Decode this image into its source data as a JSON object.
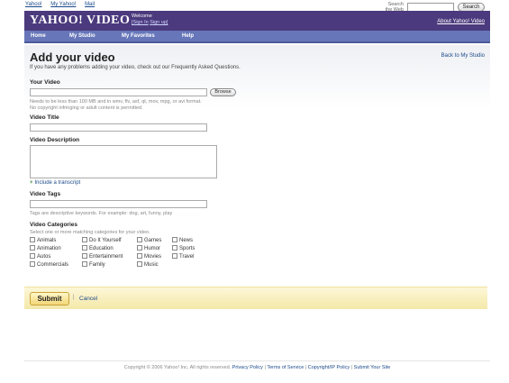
{
  "topnav": {
    "yahoo": "Yahoo!",
    "my_yahoo": "My Yahoo!",
    "mail": "Mail"
  },
  "search": {
    "label_line1": "Search",
    "label_line2": "the Web",
    "button": "Search"
  },
  "header": {
    "logo": "YAHOO! VIDEO",
    "welcome": "Welcome",
    "signin": "[Sign In",
    "signup": "Sign up]",
    "about": "About Yahoo! Video"
  },
  "menu": [
    "Home",
    "My Studio",
    "My Favorites",
    "Help"
  ],
  "page": {
    "title": "Add your video",
    "subtitle": "If you have any problems adding your video, check out our Frequently Asked Questions.",
    "back": "Back to My Studio"
  },
  "form": {
    "video": {
      "label": "Your Video",
      "browse": "Browse",
      "hint1": "Needs to be less than 100 MB and in wmv, flv, asf, qt, mov, mpg, or avi format.",
      "hint2": "No copyright infringing or adult content is permitted."
    },
    "title": {
      "label": "Video Title"
    },
    "description": {
      "label": "Video Description",
      "transcript": "Include a transcript"
    },
    "tags": {
      "label": "Video Tags",
      "hint": "Tags are descriptive keywords. For example: dog, art, funny, play"
    },
    "categories": {
      "label": "Video Categories",
      "hint": "Select one or more matching categories for your video.",
      "items": [
        [
          "Animals",
          "Animation",
          "Autos",
          "Commercials"
        ],
        [
          "Do It Yourself",
          "Education",
          "Entertainment",
          "Family"
        ],
        [
          "Games",
          "Humor",
          "Movies",
          "Music"
        ],
        [
          "News",
          "Sports",
          "Travel"
        ]
      ]
    }
  },
  "actions": {
    "submit": "Submit",
    "separator": "|",
    "cancel": "Cancel"
  },
  "footer": {
    "copyright": "Copyright © 2006 Yahoo! Inc. All rights reserved.",
    "privacy": "Privacy Policy",
    "terms": "Terms of Service",
    "copyright_ip": "Copyright/IP Policy",
    "submit_site": "Submit Your Site"
  }
}
